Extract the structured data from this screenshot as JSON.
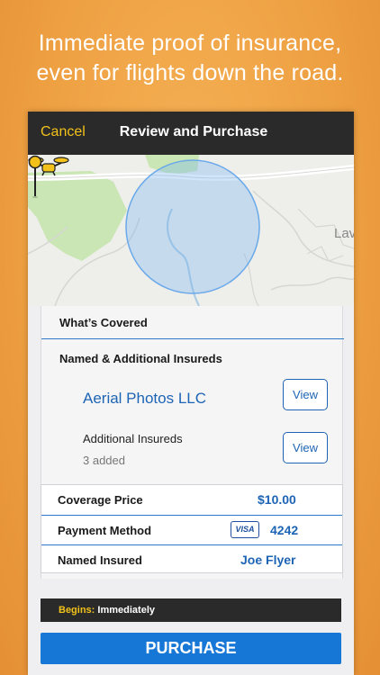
{
  "headline": {
    "line1": "Immediate proof of insurance,",
    "line2": "even for flights down the road."
  },
  "navbar": {
    "cancel_label": "Cancel",
    "title": "Review and Purchase"
  },
  "map": {
    "partial_label": "Lav"
  },
  "coverage": {
    "whats_covered": "What’s Covered",
    "named_additional": "Named & Additional Insureds",
    "company_name": "Aerial Photos LLC",
    "view_label": "View",
    "additional_title": "Additional Insureds",
    "additional_count": "3 added"
  },
  "summary": {
    "coverage_price_label": "Coverage Price",
    "coverage_price_value": "$10.00",
    "payment_method_label": "Payment Method",
    "card_brand": "VISA",
    "card_last4": "4242",
    "named_insured_label": "Named Insured",
    "named_insured_value": "Joe Flyer"
  },
  "begins": {
    "label": "Begins:",
    "value": "Immediately"
  },
  "purchase_label": "PURCHASE",
  "colors": {
    "accent_yellow": "#f2c21a",
    "link_blue": "#1e64b4",
    "purchase_blue": "#1777d6",
    "background_orange": "#eea143"
  }
}
